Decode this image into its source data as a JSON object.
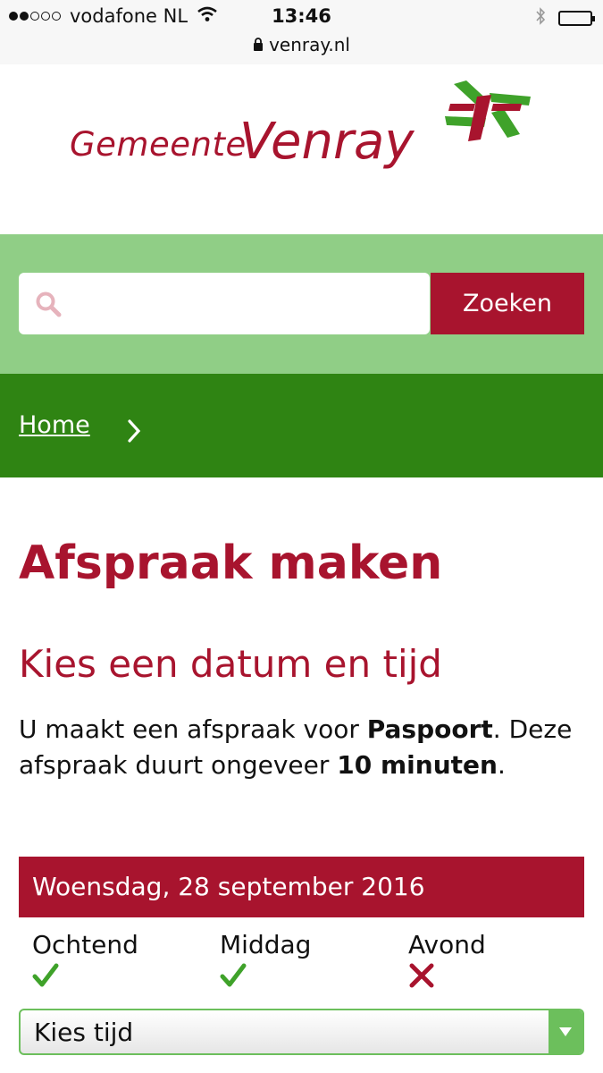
{
  "status_bar": {
    "carrier": "vodafone NL",
    "time": "13:46",
    "url": "venray.nl",
    "signal_bars_filled": 2,
    "signal_bars_total": 5
  },
  "logo": {
    "prefix": "Gemeente",
    "name": "Venray",
    "icon": "venray-cross-logo"
  },
  "search": {
    "placeholder": "",
    "value": "",
    "button_label": "Zoeken",
    "icon": "search-icon"
  },
  "breadcrumb": {
    "home_label": "Home",
    "separator_icon": "chevron-right-icon"
  },
  "page": {
    "title": "Afspraak maken",
    "subtitle": "Kies een datum en tijd",
    "intro_prefix": "U maakt een afspraak voor ",
    "product": "Paspoort",
    "intro_mid": ". Deze afspraak duurt ongeveer ",
    "duration": "10 minuten",
    "intro_suffix": "."
  },
  "date": {
    "label": "Woensdag, 28 september 2016",
    "slots": [
      {
        "label": "Ochtend",
        "available": true
      },
      {
        "label": "Middag",
        "available": true
      },
      {
        "label": "Avond",
        "available": false
      }
    ],
    "select_label": "Kies tijd"
  },
  "colors": {
    "brand_red": "#a8142e",
    "light_green": "#90ce86",
    "dark_green": "#2f8413",
    "check_green": "#3fa22a"
  }
}
